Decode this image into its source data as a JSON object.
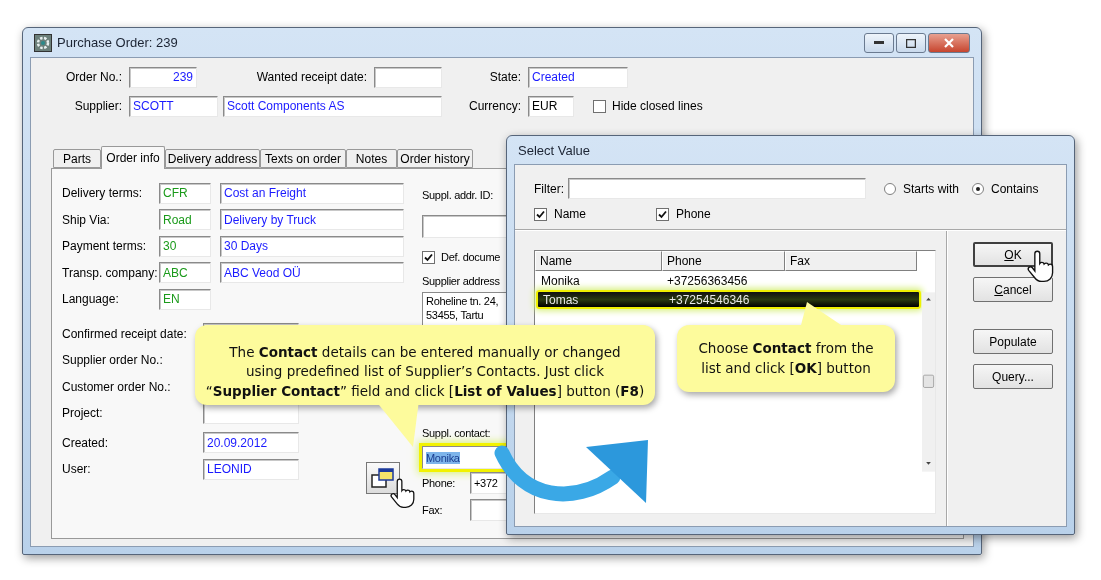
{
  "main_window": {
    "title": "Purchase Order: 239",
    "header": {
      "order_no": {
        "label": "Order No.:",
        "value": "239"
      },
      "wanted_receipt_date": {
        "label": "Wanted receipt date:"
      },
      "state": {
        "label": "State:",
        "value": "Created"
      },
      "supplier": {
        "label": "Supplier:",
        "code": "SCOTT",
        "name": "Scott Components AS"
      },
      "currency": {
        "label": "Currency:",
        "value": "EUR"
      },
      "hide_closed_lines": {
        "label": "Hide closed lines",
        "checked": false
      }
    },
    "tabs": [
      {
        "label": "Parts",
        "selected": false
      },
      {
        "label": "Order info",
        "selected": true
      },
      {
        "label": "Delivery address",
        "selected": false
      },
      {
        "label": "Texts on order",
        "selected": false
      },
      {
        "label": "Notes",
        "selected": false
      },
      {
        "label": "Order history",
        "selected": false
      }
    ],
    "order_info": {
      "terms": [
        {
          "label": "Delivery terms:",
          "code": "CFR",
          "description": "Cost an Freight"
        },
        {
          "label": "Ship Via:",
          "code": "Road",
          "description": "Delivery by Truck"
        },
        {
          "label": "Payment terms:",
          "code": "30",
          "description": "30 Days"
        },
        {
          "label": "Transp. company:",
          "code": "ABC",
          "description": "ABC Veod OÜ"
        },
        {
          "label": "Language:",
          "code": "EN"
        }
      ],
      "references": [
        {
          "label": "Confirmed receipt date:"
        },
        {
          "label": "Supplier order No.:"
        },
        {
          "label": "Customer order No.:"
        },
        {
          "label": "Project:"
        }
      ],
      "record": [
        {
          "label": "Created:",
          "value": "20.09.2012"
        },
        {
          "label": "User:",
          "value": "LEONID"
        }
      ],
      "supplier_address_id": {
        "label": "Suppl. addr. ID:"
      },
      "def_document": {
        "label": "Def. docume",
        "checked": true
      },
      "supplier_address": {
        "label": "Supplier address",
        "lines": [
          "Roheline tn. 24,",
          "53455, Tartu"
        ]
      },
      "supplier_contact": {
        "label": "Suppl. contact:",
        "value": "Monika",
        "text_selected": true,
        "highlighted": true
      },
      "phone": {
        "label": "Phone:",
        "value": "+372"
      },
      "fax": {
        "label": "Fax:"
      }
    }
  },
  "select_value_dialog": {
    "title": "Select Value",
    "filter": {
      "label": "Filter:"
    },
    "match_modes": [
      {
        "label": "Starts with",
        "selected": false
      },
      {
        "label": "Contains",
        "selected": true
      }
    ],
    "search_columns": [
      {
        "label": "Name",
        "checked": true
      },
      {
        "label": "Phone",
        "checked": true
      }
    ],
    "list": {
      "columns": [
        "Name",
        "Phone",
        "Fax"
      ],
      "rows": [
        {
          "name": "Monika",
          "phone": "+37256363456",
          "selected": false
        },
        {
          "name": "Tomas",
          "phone": "+37254546346",
          "selected": true
        }
      ]
    },
    "button_groups": [
      {
        "buttons": [
          {
            "label": "OK",
            "default": true,
            "mnemonic": true
          },
          {
            "label": "Cancel",
            "default": false,
            "mnemonic": true
          }
        ]
      },
      {
        "buttons": [
          {
            "label": "Populate",
            "default": false,
            "mnemonic": false
          },
          {
            "label": "Query...",
            "default": false,
            "mnemonic": false
          }
        ]
      }
    ]
  },
  "callouts": [
    {
      "text": "The **Contact** details can be entered manually or changed\nusing predefined list of Supplier’s Contacts.  Just click\n“**Supplier Contact**” field and click [**List of Values**] button (**F8**)"
    },
    {
      "text": "Choose **Contact** from the\nlist and click [**OK**] button"
    }
  ]
}
